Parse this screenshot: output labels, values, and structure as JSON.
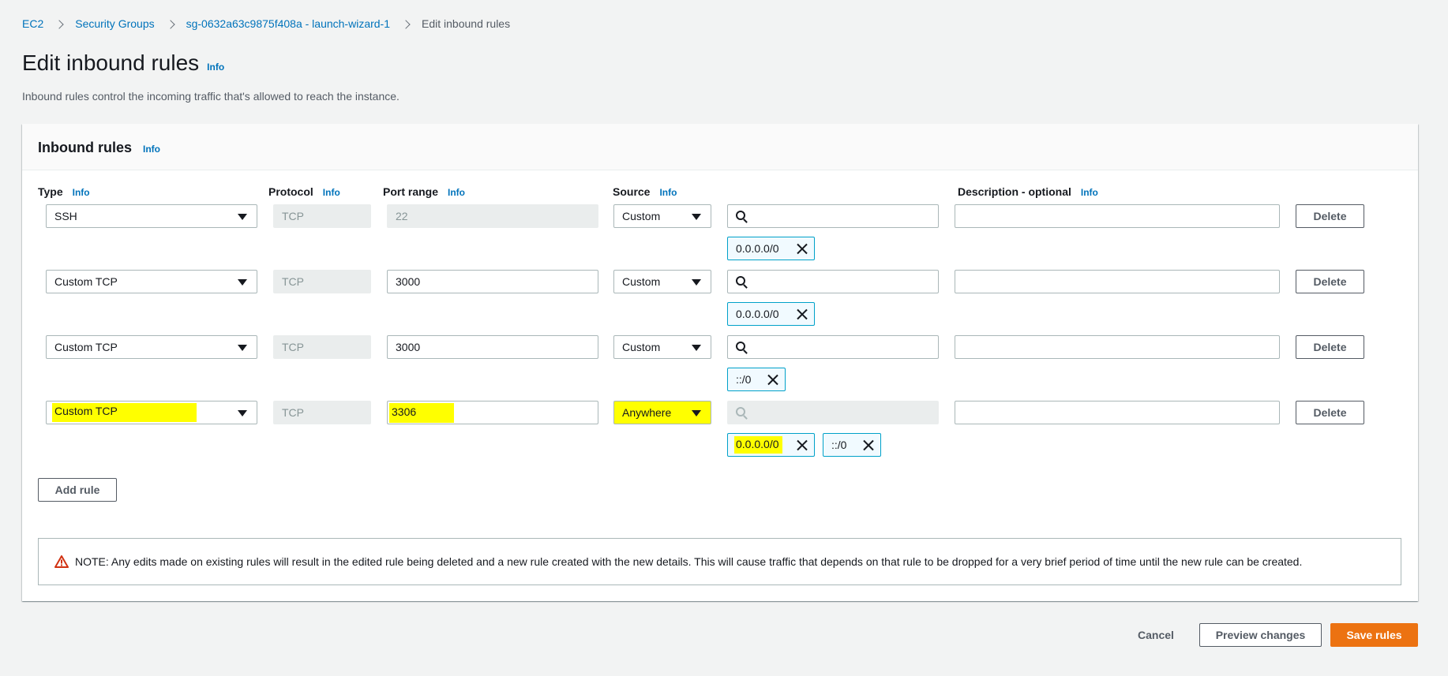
{
  "breadcrumb": {
    "items": [
      "EC2",
      "Security Groups",
      "sg-0632a63c9875f408a - launch-wizard-1"
    ],
    "current": "Edit inbound rules"
  },
  "page": {
    "title": "Edit inbound rules",
    "info": "Info",
    "description": "Inbound rules control the incoming traffic that's allowed to reach the instance."
  },
  "panel": {
    "title": "Inbound rules",
    "info": "Info",
    "columns": {
      "type": "Type",
      "protocol": "Protocol",
      "port_range": "Port range",
      "source": "Source",
      "description": "Description - optional",
      "info": "Info"
    }
  },
  "rules": [
    {
      "type": "SSH",
      "protocol": "TCP",
      "port": "22",
      "source": "Custom",
      "tokens": [
        "0.0.0.0/0"
      ],
      "description": "",
      "delete": "Delete"
    },
    {
      "type": "Custom TCP",
      "protocol": "TCP",
      "port": "3000",
      "source": "Custom",
      "tokens": [
        "0.0.0.0/0"
      ],
      "description": "",
      "delete": "Delete"
    },
    {
      "type": "Custom TCP",
      "protocol": "TCP",
      "port": "3000",
      "source": "Custom",
      "tokens": [
        "::/0"
      ],
      "description": "",
      "delete": "Delete"
    },
    {
      "type": "Custom TCP",
      "protocol": "TCP",
      "port": "3306",
      "source": "Anywhere",
      "tokens": [
        "0.0.0.0/0",
        "::/0"
      ],
      "description": "",
      "delete": "Delete"
    }
  ],
  "add_rule": "Add rule",
  "alert": {
    "text": "NOTE: Any edits made on existing rules will result in the edited rule being deleted and a new rule created with the new details. This will cause traffic that depends on that rule to be dropped for a very brief period of time until the new rule can be created."
  },
  "footer": {
    "cancel": "Cancel",
    "preview": "Preview changes",
    "save": "Save rules"
  },
  "colors": {
    "link": "#0073bb",
    "primary": "#ec7211",
    "highlight": "#ffff00",
    "token_border": "#00a1c9",
    "warning": "#d13212"
  }
}
